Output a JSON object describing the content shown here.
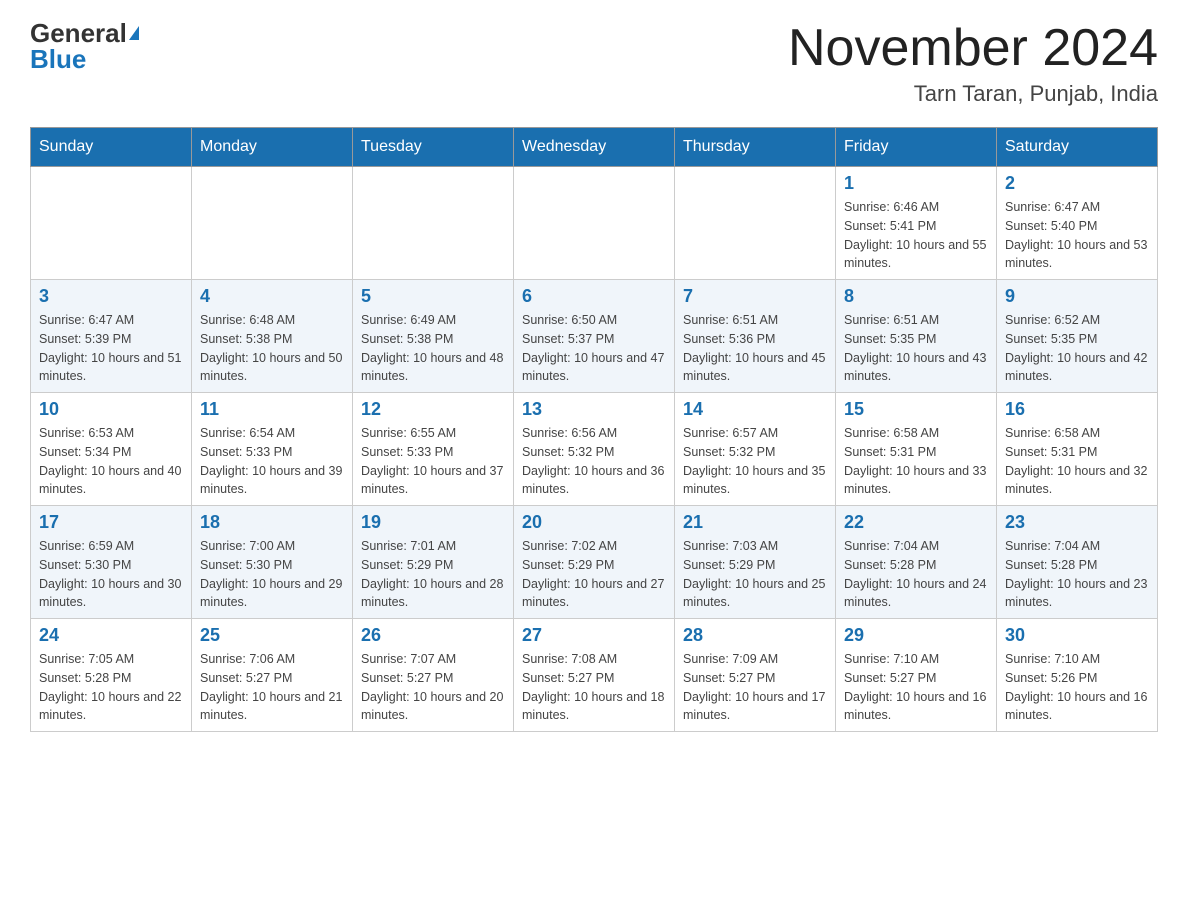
{
  "header": {
    "logo_general": "General",
    "logo_blue": "Blue",
    "month_title": "November 2024",
    "location": "Tarn Taran, Punjab, India"
  },
  "weekdays": [
    "Sunday",
    "Monday",
    "Tuesday",
    "Wednesday",
    "Thursday",
    "Friday",
    "Saturday"
  ],
  "weeks": [
    [
      {
        "day": "",
        "info": ""
      },
      {
        "day": "",
        "info": ""
      },
      {
        "day": "",
        "info": ""
      },
      {
        "day": "",
        "info": ""
      },
      {
        "day": "",
        "info": ""
      },
      {
        "day": "1",
        "info": "Sunrise: 6:46 AM\nSunset: 5:41 PM\nDaylight: 10 hours and 55 minutes."
      },
      {
        "day": "2",
        "info": "Sunrise: 6:47 AM\nSunset: 5:40 PM\nDaylight: 10 hours and 53 minutes."
      }
    ],
    [
      {
        "day": "3",
        "info": "Sunrise: 6:47 AM\nSunset: 5:39 PM\nDaylight: 10 hours and 51 minutes."
      },
      {
        "day": "4",
        "info": "Sunrise: 6:48 AM\nSunset: 5:38 PM\nDaylight: 10 hours and 50 minutes."
      },
      {
        "day": "5",
        "info": "Sunrise: 6:49 AM\nSunset: 5:38 PM\nDaylight: 10 hours and 48 minutes."
      },
      {
        "day": "6",
        "info": "Sunrise: 6:50 AM\nSunset: 5:37 PM\nDaylight: 10 hours and 47 minutes."
      },
      {
        "day": "7",
        "info": "Sunrise: 6:51 AM\nSunset: 5:36 PM\nDaylight: 10 hours and 45 minutes."
      },
      {
        "day": "8",
        "info": "Sunrise: 6:51 AM\nSunset: 5:35 PM\nDaylight: 10 hours and 43 minutes."
      },
      {
        "day": "9",
        "info": "Sunrise: 6:52 AM\nSunset: 5:35 PM\nDaylight: 10 hours and 42 minutes."
      }
    ],
    [
      {
        "day": "10",
        "info": "Sunrise: 6:53 AM\nSunset: 5:34 PM\nDaylight: 10 hours and 40 minutes."
      },
      {
        "day": "11",
        "info": "Sunrise: 6:54 AM\nSunset: 5:33 PM\nDaylight: 10 hours and 39 minutes."
      },
      {
        "day": "12",
        "info": "Sunrise: 6:55 AM\nSunset: 5:33 PM\nDaylight: 10 hours and 37 minutes."
      },
      {
        "day": "13",
        "info": "Sunrise: 6:56 AM\nSunset: 5:32 PM\nDaylight: 10 hours and 36 minutes."
      },
      {
        "day": "14",
        "info": "Sunrise: 6:57 AM\nSunset: 5:32 PM\nDaylight: 10 hours and 35 minutes."
      },
      {
        "day": "15",
        "info": "Sunrise: 6:58 AM\nSunset: 5:31 PM\nDaylight: 10 hours and 33 minutes."
      },
      {
        "day": "16",
        "info": "Sunrise: 6:58 AM\nSunset: 5:31 PM\nDaylight: 10 hours and 32 minutes."
      }
    ],
    [
      {
        "day": "17",
        "info": "Sunrise: 6:59 AM\nSunset: 5:30 PM\nDaylight: 10 hours and 30 minutes."
      },
      {
        "day": "18",
        "info": "Sunrise: 7:00 AM\nSunset: 5:30 PM\nDaylight: 10 hours and 29 minutes."
      },
      {
        "day": "19",
        "info": "Sunrise: 7:01 AM\nSunset: 5:29 PM\nDaylight: 10 hours and 28 minutes."
      },
      {
        "day": "20",
        "info": "Sunrise: 7:02 AM\nSunset: 5:29 PM\nDaylight: 10 hours and 27 minutes."
      },
      {
        "day": "21",
        "info": "Sunrise: 7:03 AM\nSunset: 5:29 PM\nDaylight: 10 hours and 25 minutes."
      },
      {
        "day": "22",
        "info": "Sunrise: 7:04 AM\nSunset: 5:28 PM\nDaylight: 10 hours and 24 minutes."
      },
      {
        "day": "23",
        "info": "Sunrise: 7:04 AM\nSunset: 5:28 PM\nDaylight: 10 hours and 23 minutes."
      }
    ],
    [
      {
        "day": "24",
        "info": "Sunrise: 7:05 AM\nSunset: 5:28 PM\nDaylight: 10 hours and 22 minutes."
      },
      {
        "day": "25",
        "info": "Sunrise: 7:06 AM\nSunset: 5:27 PM\nDaylight: 10 hours and 21 minutes."
      },
      {
        "day": "26",
        "info": "Sunrise: 7:07 AM\nSunset: 5:27 PM\nDaylight: 10 hours and 20 minutes."
      },
      {
        "day": "27",
        "info": "Sunrise: 7:08 AM\nSunset: 5:27 PM\nDaylight: 10 hours and 18 minutes."
      },
      {
        "day": "28",
        "info": "Sunrise: 7:09 AM\nSunset: 5:27 PM\nDaylight: 10 hours and 17 minutes."
      },
      {
        "day": "29",
        "info": "Sunrise: 7:10 AM\nSunset: 5:27 PM\nDaylight: 10 hours and 16 minutes."
      },
      {
        "day": "30",
        "info": "Sunrise: 7:10 AM\nSunset: 5:26 PM\nDaylight: 10 hours and 16 minutes."
      }
    ]
  ]
}
